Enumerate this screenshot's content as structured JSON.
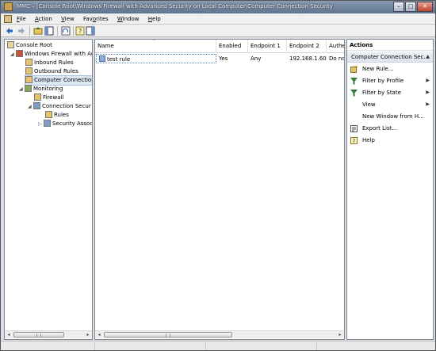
{
  "window": {
    "title": "MMC – [Console Root\\Windows Firewall with Advanced Security on Local Computer\\Computer Connection Security]",
    "controls": {
      "minimize": "–",
      "maximize": "□",
      "close": "✕"
    }
  },
  "menu": {
    "items": [
      {
        "u": "F",
        "rest": "ile"
      },
      {
        "u": "A",
        "rest": "ction"
      },
      {
        "u": "V",
        "rest": "iew"
      },
      {
        "u": "",
        "pre": "Fav",
        "mid": "o",
        "rest": "rites"
      },
      {
        "u": "W",
        "rest": "indow"
      },
      {
        "u": "H",
        "rest": "elp"
      }
    ],
    "favorites_full": "Favorites"
  },
  "tree": {
    "items": [
      {
        "label": "Console Root",
        "icon": "folder-icon",
        "color": "#e8d49a"
      },
      {
        "label": "Windows Firewall with Ac",
        "icon": "firewall-icon",
        "color": "#c8543a"
      },
      {
        "label": "Inbound Rules",
        "icon": "inbound-rules-icon",
        "color": "#e6c36b"
      },
      {
        "label": "Outbound Rules",
        "icon": "outbound-rules-icon",
        "color": "#e6c36b"
      },
      {
        "label": "Computer Connection",
        "icon": "connection-security-icon",
        "color": "#e6c36b"
      },
      {
        "label": "Monitoring",
        "icon": "monitoring-icon",
        "color": "#8aa75a"
      },
      {
        "label": "Firewall",
        "icon": "firewall-icon",
        "color": "#e6c36b"
      },
      {
        "label": "Connection Secur",
        "icon": "connection-security-icon",
        "color": "#7f9cc6"
      },
      {
        "label": "Rules",
        "icon": "rules-icon",
        "color": "#e6c36b"
      },
      {
        "label": "Security Assoc",
        "icon": "security-association-icon",
        "color": "#7f9cc6"
      }
    ]
  },
  "list": {
    "columns": [
      "Name",
      "Enabled",
      "Endpoint 1",
      "Endpoint 2",
      "Authe"
    ],
    "rows": [
      {
        "name": "test rule",
        "enabled": "Yes",
        "endpoint1": "Any",
        "endpoint2": "192.168.1.60",
        "auth": "Do no"
      }
    ]
  },
  "actions": {
    "title": "Actions",
    "section": "Computer Connection Sec...",
    "items": [
      {
        "label": "New Rule...",
        "icon": "new-rule-icon",
        "submenu": false
      },
      {
        "label": "Filter by Profile",
        "icon": "filter-icon",
        "submenu": true
      },
      {
        "label": "Filter by State",
        "icon": "filter-icon",
        "submenu": true
      },
      {
        "label": "View",
        "icon": "",
        "submenu": true
      },
      {
        "label": "New Window from H...",
        "icon": "",
        "submenu": false
      },
      {
        "label": "Export List...",
        "icon": "export-list-icon",
        "submenu": false
      },
      {
        "label": "Help",
        "icon": "help-icon",
        "submenu": false
      }
    ]
  },
  "colors": {
    "selection": "#dde7f3",
    "title_bar": "#5f7390",
    "filter_icon": "#2f7d32"
  }
}
